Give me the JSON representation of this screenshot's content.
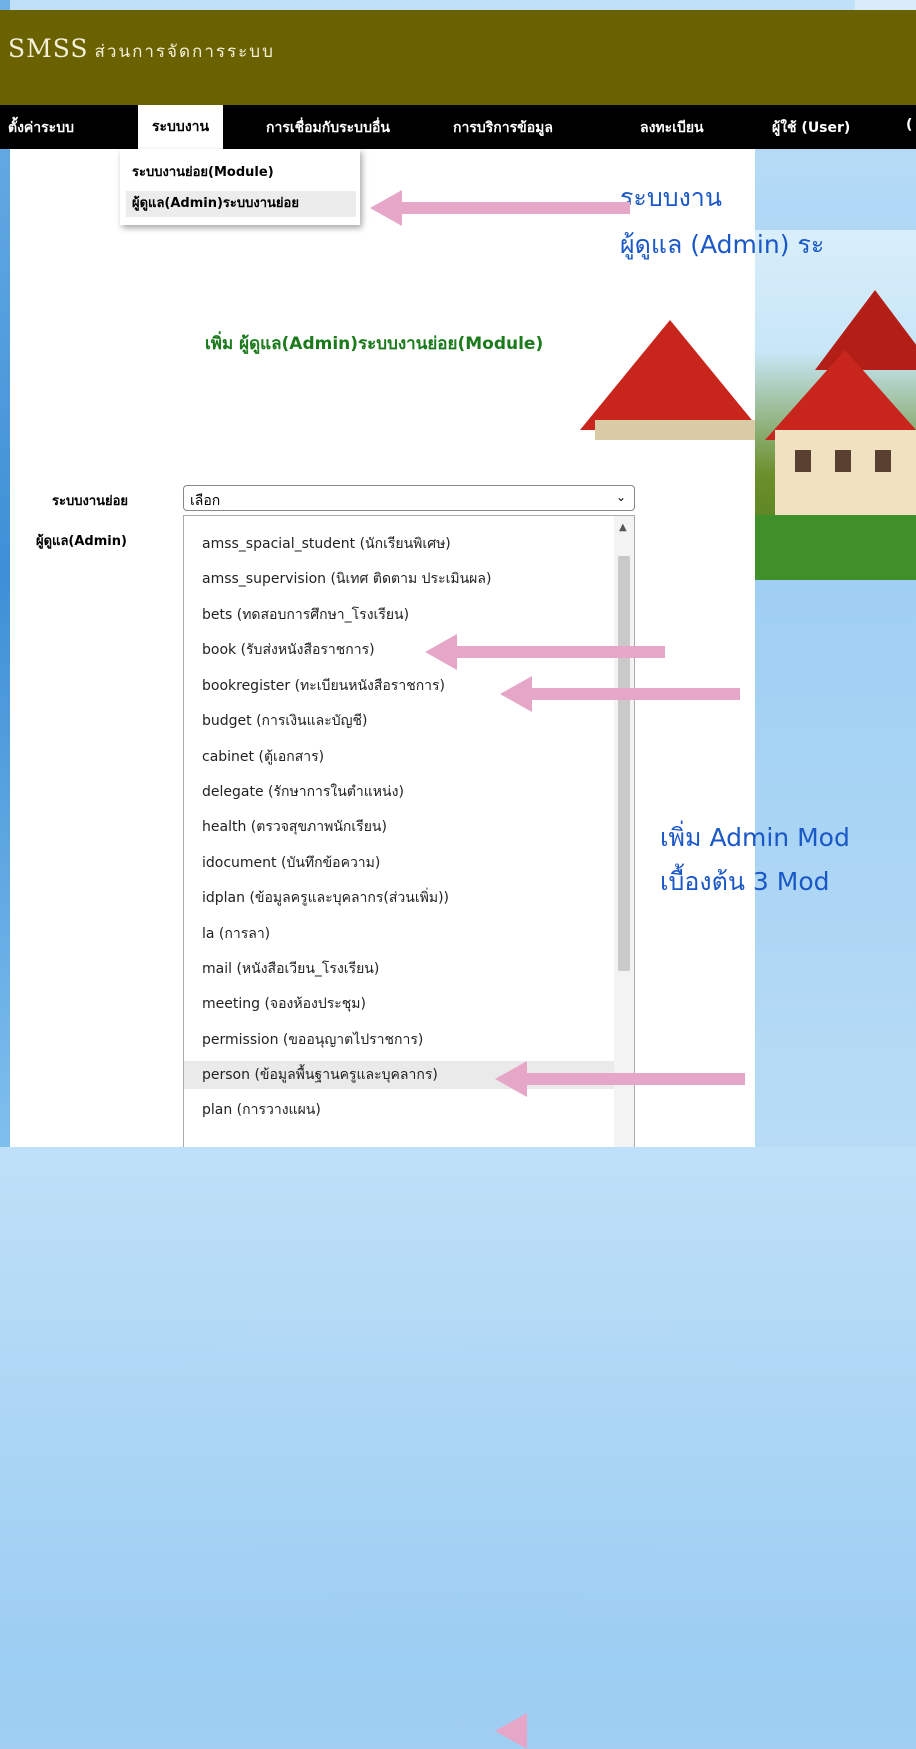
{
  "header": {
    "brand": "SMSS",
    "subtitle": "ส่วนการจัดการระบบ"
  },
  "menubar": {
    "items": [
      {
        "label": "ตั้งค่าระบบ"
      },
      {
        "label": "ระบบงาน"
      },
      {
        "label": "การเชื่อมกับระบบอื่น"
      },
      {
        "label": "การบริการข้อมูล"
      },
      {
        "label": "ลงทะเบียน"
      },
      {
        "label": "ผู้ใช้ (User)"
      },
      {
        "label": "("
      }
    ],
    "submenu": [
      {
        "label": "ระบบงานย่อย(Module)"
      },
      {
        "label": "ผู้ดูแล(Admin)ระบบงานย่อย"
      }
    ]
  },
  "annotations": {
    "top_line1": "ระบบงาน",
    "top_line2": "ผู้ดูแล (Admin) ระ",
    "mid_line1": "เพิ่ม Admin Mod",
    "mid_line2": "เบื้องต้น 3 Mod"
  },
  "form": {
    "title": "เพิ่ม ผู้ดูแล(Admin)ระบบงานย่อย(Module)",
    "module_label": "ระบบงานย่อย",
    "admin_label": "ผู้ดูแล(Admin)",
    "select_value": "เลือก",
    "options": [
      "amss_spacial_student (นักเรียนพิเศษ)",
      "amss_supervision (นิเทศ ติดตาม ประเมินผล)",
      "bets (ทดสอบการศึกษา_โรงเรียน)",
      "book (รับส่งหนังสือราชการ)",
      "bookregister (ทะเบียนหนังสือราชการ)",
      "budget (การเงินและบัญชี)",
      "cabinet (ตู้เอกสาร)",
      "delegate (รักษาการในตำแหน่ง)",
      "health (ตรวจสุขภาพนักเรียน)",
      "idocument (บันทึกข้อความ)",
      "idplan (ข้อมูลครูและบุคลากร(ส่วนเพิ่ม))",
      "la (การลา)",
      "mail (หนังสือเวียน_โรงเรียน)",
      "meeting (จองห้องประชุม)",
      "permission (ขออนุญาตไปราชการ)",
      "person (ข้อมูลพื้นฐานครูและบุคลากร)",
      "plan (การวางแผน)"
    ],
    "highlighted_option": "person (ข้อมูลพื้นฐานครูและบุคลากร)"
  },
  "colors": {
    "header_bg": "#6a6200",
    "menubar_bg": "#000000",
    "annotation_text": "#1a57c7",
    "form_title": "#1b7a1b",
    "arrow": "#e6a6c8"
  }
}
